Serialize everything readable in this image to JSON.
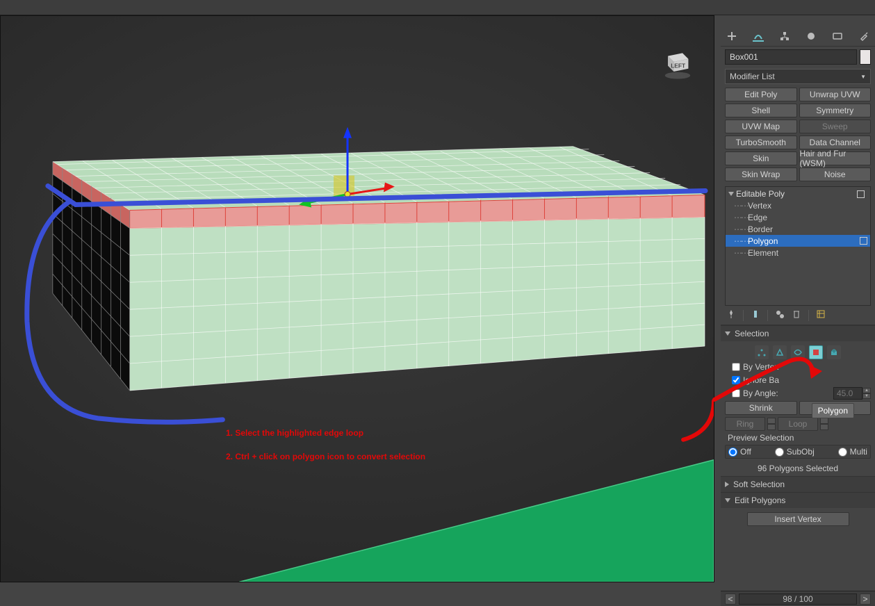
{
  "object_name": "Box001",
  "modifier_dropdown": "Modifier List",
  "modifier_buttons": [
    {
      "id": "edit-poly",
      "label": "Edit Poly"
    },
    {
      "id": "unwrap-uvw",
      "label": "Unwrap UVW"
    },
    {
      "id": "shell",
      "label": "Shell"
    },
    {
      "id": "symmetry",
      "label": "Symmetry"
    },
    {
      "id": "uvw-map",
      "label": "UVW Map"
    },
    {
      "id": "sweep",
      "label": "Sweep",
      "disabled": true
    },
    {
      "id": "turbosmooth",
      "label": "TurboSmooth"
    },
    {
      "id": "data-channel",
      "label": "Data Channel"
    },
    {
      "id": "skin",
      "label": "Skin"
    },
    {
      "id": "hair-fur",
      "label": "Hair and Fur (WSM)"
    },
    {
      "id": "skin-wrap",
      "label": "Skin Wrap"
    },
    {
      "id": "noise",
      "label": "Noise"
    }
  ],
  "stack": {
    "modifier": "Editable Poly",
    "subobjects": [
      "Vertex",
      "Edge",
      "Border",
      "Polygon",
      "Element"
    ],
    "selected": "Polygon"
  },
  "selection": {
    "heading": "Selection",
    "by_vertex_label": "By Vertex",
    "ignore_backfacing_label": "Ignore Ba",
    "ignore_backfacing_checked": true,
    "by_angle_label": "By Angle:",
    "by_angle_value": "45.0",
    "shrink_label": "Shrink",
    "grow_label": "Grow",
    "ring_label": "Ring",
    "loop_label": "Loop",
    "preview_label": "Preview Selection",
    "preview_options": {
      "off": "Off",
      "subobj": "SubObj",
      "multi": "Multi"
    },
    "preview_selected": "off",
    "polycount": "96 Polygons Selected"
  },
  "soft_selection": {
    "heading": "Soft Selection"
  },
  "edit_polygons": {
    "heading": "Edit Polygons",
    "insert_vertex": "Insert Vertex"
  },
  "tooltip": "Polygon",
  "annotation": {
    "line1": "1. Select the highlighted edge loop",
    "line2": "2. Ctrl + click on polygon icon to convert selection"
  },
  "viewcube_face": "LEFT",
  "footer": {
    "page": "98 / 100"
  },
  "icons": {
    "vertex": "vertex",
    "edge": "edge",
    "border": "border",
    "polygon": "polygon",
    "element": "element"
  }
}
